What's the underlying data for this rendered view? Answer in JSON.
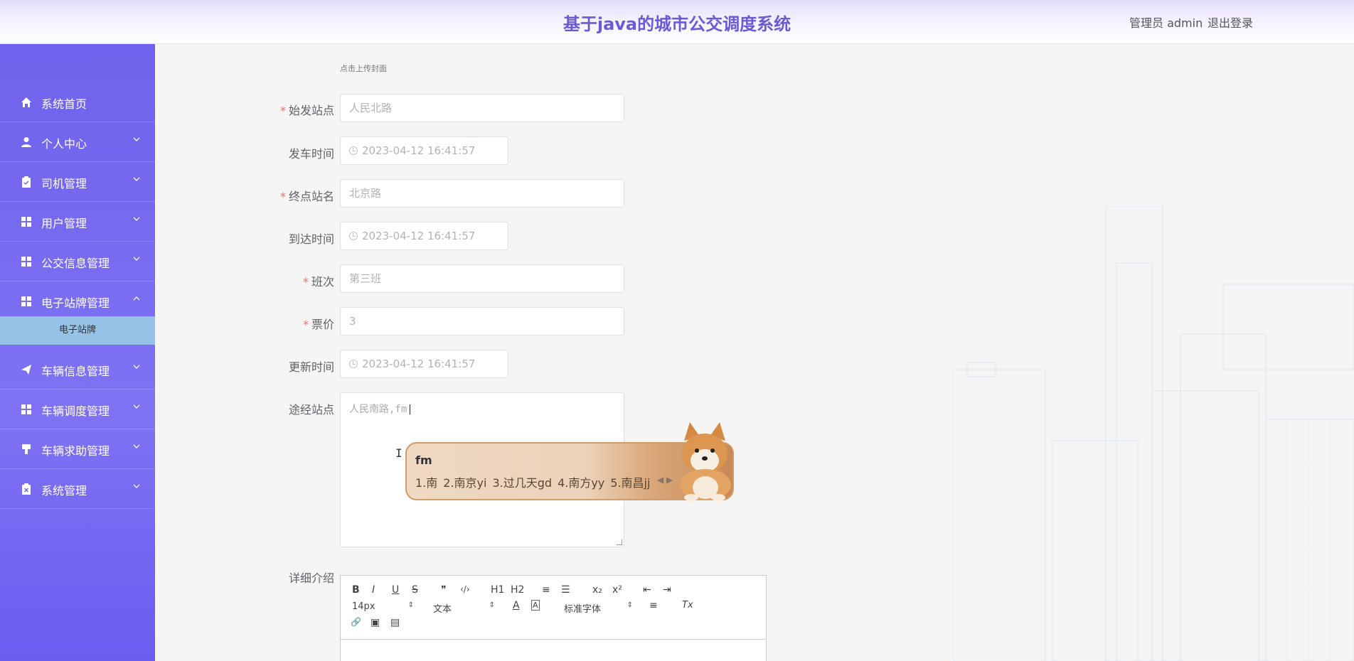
{
  "header": {
    "title": "基于java的城市公交调度系统",
    "user_label": "管理员 admin",
    "logout_label": "退出登录"
  },
  "sidebar": {
    "items": [
      {
        "label": "系统首页",
        "icon": "home-icon"
      },
      {
        "label": "个人中心",
        "icon": "user-icon"
      },
      {
        "label": "司机管理",
        "icon": "clipboard-icon"
      },
      {
        "label": "用户管理",
        "icon": "grid-icon"
      },
      {
        "label": "公交信息管理",
        "icon": "grid-icon"
      },
      {
        "label": "电子站牌管理",
        "icon": "grid-icon"
      },
      {
        "label": "车辆信息管理",
        "icon": "send-icon"
      },
      {
        "label": "车辆调度管理",
        "icon": "grid-icon"
      },
      {
        "label": "车辆求助管理",
        "icon": "pin-icon"
      },
      {
        "label": "系统管理",
        "icon": "clipboard-x-icon"
      }
    ],
    "active_sub": "电子站牌"
  },
  "form": {
    "upload_hint": "点击上传封面",
    "start_station": {
      "label": "始发站点",
      "required": true,
      "value": "人民北路"
    },
    "depart_time": {
      "label": "发车时间",
      "value": "2023-04-12 16:41:57"
    },
    "end_station": {
      "label": "终点站名",
      "required": true,
      "value": "北京路"
    },
    "arrive_time": {
      "label": "到达时间",
      "value": "2023-04-12 16:41:57"
    },
    "shift": {
      "label": "班次",
      "required": true,
      "value": "第三班"
    },
    "price": {
      "label": "票价",
      "required": true,
      "value": "3"
    },
    "update_time": {
      "label": "更新时间",
      "value": "2023-04-12 16:41:57"
    },
    "route": {
      "label": "途经站点",
      "value": "人民南路,fm"
    },
    "detail": {
      "label": "详细介绍"
    }
  },
  "ime": {
    "composition": "fm",
    "candidates": [
      "1.南",
      "2.南京yi",
      "3.过几天gd",
      "4.南方yy",
      "5.南昌jj"
    ]
  },
  "editor": {
    "font_size": "14px",
    "paragraph": "文本",
    "font_family": "标准字体",
    "buttons": {
      "bold": "B",
      "italic": "I",
      "underline": "U",
      "strike": "S",
      "quote": "❞",
      "code": "‹/›",
      "h1": "H1",
      "h2": "H2",
      "ordered_list": "≡",
      "bullet_list": "☰",
      "subscript": "x₂",
      "superscript": "x²",
      "outdent": "⇤",
      "indent": "⇥",
      "color": "A",
      "background": "A",
      "align": "≡",
      "clean": "Tx",
      "link": "🔗",
      "image": "▣",
      "video": "▤"
    }
  },
  "colors": {
    "primary": "#6a5ad8",
    "sidebar_top": "#6f62ec",
    "submenu_active": "#95c2e6",
    "required": "#f56c6c"
  }
}
